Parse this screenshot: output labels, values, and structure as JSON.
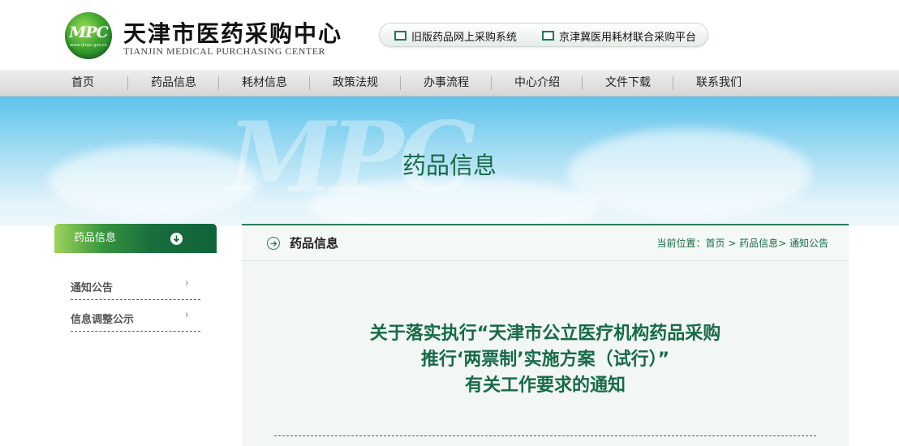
{
  "header": {
    "logo_text": "MPC",
    "logo_url": "www.tjmpc.gov.cn",
    "title": "天津市医药采购中心",
    "subtitle": "TIANJIN MEDICAL PURCHASING CENTER",
    "quick_links": [
      {
        "label": "旧版药品网上采购系统",
        "icon": "window-icon"
      },
      {
        "label": "京津冀医用耗材联合采购平台",
        "icon": "window-icon"
      }
    ]
  },
  "nav": {
    "items": [
      "首页",
      "药品信息",
      "耗材信息",
      "政策法规",
      "办事流程",
      "中心介绍",
      "文件下载",
      "联系我们"
    ]
  },
  "banner": {
    "title": "药品信息",
    "watermark": "MPC"
  },
  "sidebar": {
    "header": "药品信息",
    "header_icon": "arrow-down-circle-icon",
    "items": [
      {
        "label": "通知公告",
        "arrow": "›"
      },
      {
        "label": "信息调整公示",
        "arrow": "›"
      }
    ]
  },
  "main": {
    "title": "药品信息",
    "title_icon": "arrow-right-circle-icon",
    "breadcrumb": "当前位置：首页 > 药品信息> 通知公告",
    "article_title_lines": [
      "关于落实执行“天津市公立医疗机构药品采购",
      "推行‘两票制’实施方案（试行）”",
      "有关工作要求的通知"
    ]
  },
  "colors": {
    "brand_green": "#176a47",
    "sidebar_head_green": "#10643a",
    "banner_blue": "#5cc3ec"
  }
}
